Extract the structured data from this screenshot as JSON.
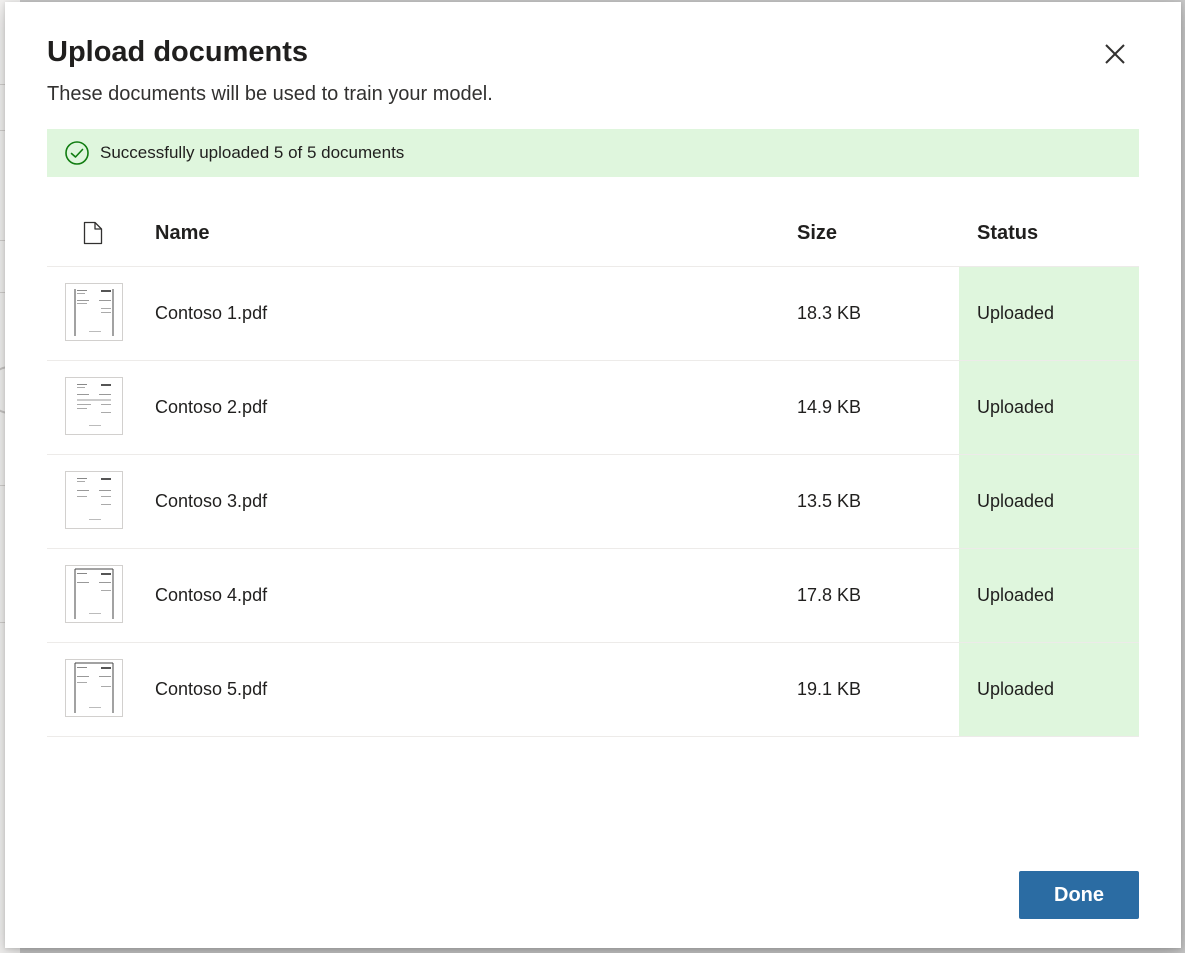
{
  "dialog": {
    "title": "Upload documents",
    "subtitle": "These documents will be used to train your model.",
    "close_icon": "close-icon"
  },
  "banner": {
    "icon": "checkmark-circle-icon",
    "message": "Successfully uploaded 5 of 5 documents",
    "color": "#dff6dd"
  },
  "table": {
    "header_icon": "document-icon",
    "columns": {
      "name": "Name",
      "size": "Size",
      "status": "Status"
    },
    "rows": [
      {
        "thumbnail": "pdf-thumbnail",
        "name": "Contoso 1.pdf",
        "size": "18.3 KB",
        "status": "Uploaded"
      },
      {
        "thumbnail": "pdf-thumbnail",
        "name": "Contoso 2.pdf",
        "size": "14.9 KB",
        "status": "Uploaded"
      },
      {
        "thumbnail": "pdf-thumbnail",
        "name": "Contoso 3.pdf",
        "size": "13.5 KB",
        "status": "Uploaded"
      },
      {
        "thumbnail": "pdf-thumbnail",
        "name": "Contoso 4.pdf",
        "size": "17.8 KB",
        "status": "Uploaded"
      },
      {
        "thumbnail": "pdf-thumbnail",
        "name": "Contoso 5.pdf",
        "size": "19.1 KB",
        "status": "Uploaded"
      }
    ]
  },
  "footer": {
    "done_label": "Done"
  },
  "colors": {
    "accent": "#2b6ca3",
    "success_bg": "#dff6dd",
    "success_icon": "#107c10"
  }
}
